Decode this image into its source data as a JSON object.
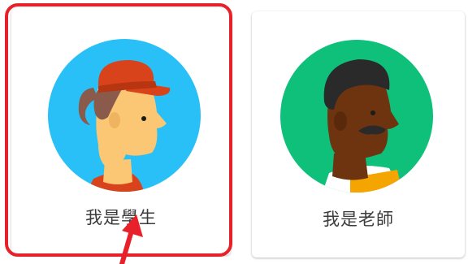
{
  "roles": {
    "student": {
      "label": "我是學生",
      "avatar_icon": "student-avatar-icon",
      "selected": true
    },
    "teacher": {
      "label": "我是老師",
      "avatar_icon": "teacher-avatar-icon",
      "selected": false
    }
  },
  "colors": {
    "highlight": "#e8202a",
    "student_bg": "#29c0f8",
    "teacher_bg": "#0ec07a",
    "cap": "#e0420f",
    "label_text": "#3c3c3c"
  }
}
